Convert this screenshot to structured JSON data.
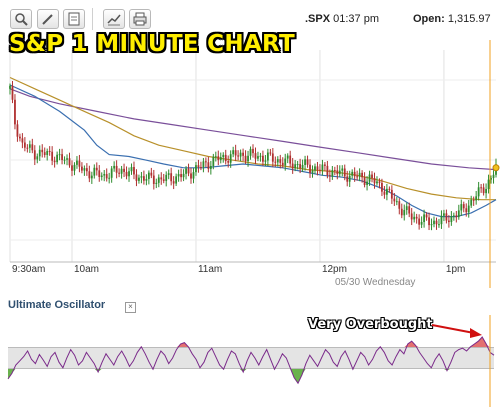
{
  "toolbar": {
    "buttons": [
      "zoom-icon",
      "pencil-icon",
      "notes-icon",
      "chart-icon",
      "print-icon"
    ],
    "symbol": ".SPX",
    "time": "01:37 pm",
    "open_label": "Open:",
    "open_value": "1,315.97"
  },
  "title": "S&P 1 MINUTE CHART",
  "colors": {
    "up_candle": "#2e8b2e",
    "down_candle": "#b03030",
    "ma_fast": "#3a6fb0",
    "ma_mid": "#b8902a",
    "ma_slow": "#7a4f9a",
    "cursor_line": "#f0a020",
    "osc_line": "#7a2a8a",
    "osc_high_fill": "#e06060",
    "osc_low_fill": "#5aaa3a",
    "osc_band": "#e4e4e4"
  },
  "chart_data": [
    {
      "type": "candlestick",
      "x_ticks": [
        "9:30am",
        "10am",
        "11am",
        "12pm",
        "1pm"
      ],
      "date_label": "05/30 Wednesday",
      "grid": true,
      "ylim": [
        0,
        100
      ],
      "close_path": [
        [
          0,
          90
        ],
        [
          2,
          72
        ],
        [
          5,
          60
        ],
        [
          10,
          56
        ],
        [
          16,
          55
        ],
        [
          22,
          52
        ],
        [
          28,
          48
        ],
        [
          33,
          45
        ],
        [
          38,
          44
        ],
        [
          45,
          47
        ],
        [
          50,
          44
        ],
        [
          56,
          42
        ],
        [
          63,
          42
        ],
        [
          70,
          44
        ],
        [
          76,
          48
        ],
        [
          82,
          52
        ],
        [
          88,
          54
        ],
        [
          94,
          55
        ],
        [
          101,
          54
        ],
        [
          108,
          52
        ],
        [
          115,
          50
        ],
        [
          122,
          48
        ],
        [
          130,
          46
        ],
        [
          137,
          44
        ],
        [
          145,
          42
        ],
        [
          150,
          38
        ],
        [
          154,
          32
        ],
        [
          158,
          26
        ],
        [
          162,
          22
        ],
        [
          166,
          20
        ],
        [
          170,
          19
        ],
        [
          174,
          20
        ],
        [
          178,
          22
        ],
        [
          182,
          25
        ],
        [
          186,
          30
        ],
        [
          190,
          36
        ],
        [
          194,
          42
        ],
        [
          196,
          48
        ]
      ],
      "ma_slow": [
        [
          0,
          90
        ],
        [
          8,
          86
        ],
        [
          20,
          82
        ],
        [
          35,
          78
        ],
        [
          50,
          74
        ],
        [
          65,
          71
        ],
        [
          80,
          68
        ],
        [
          95,
          65
        ],
        [
          110,
          62
        ],
        [
          125,
          59
        ],
        [
          140,
          56
        ],
        [
          155,
          53
        ],
        [
          170,
          50
        ],
        [
          185,
          48
        ],
        [
          196,
          47
        ]
      ],
      "ma_mid": [
        [
          0,
          96
        ],
        [
          10,
          90
        ],
        [
          20,
          84
        ],
        [
          30,
          78
        ],
        [
          40,
          72
        ],
        [
          50,
          65
        ],
        [
          60,
          60
        ],
        [
          70,
          57
        ],
        [
          80,
          54
        ],
        [
          90,
          52
        ],
        [
          100,
          50
        ],
        [
          110,
          49
        ],
        [
          120,
          47
        ],
        [
          130,
          46
        ],
        [
          140,
          44
        ],
        [
          150,
          41
        ],
        [
          160,
          37
        ],
        [
          170,
          34
        ],
        [
          180,
          32
        ],
        [
          190,
          31
        ],
        [
          196,
          31
        ]
      ],
      "ma_fast": [
        [
          0,
          92
        ],
        [
          10,
          86
        ],
        [
          20,
          78
        ],
        [
          30,
          68
        ],
        [
          35,
          60
        ],
        [
          40,
          55
        ],
        [
          48,
          54
        ],
        [
          55,
          52
        ],
        [
          62,
          50
        ],
        [
          70,
          48
        ],
        [
          78,
          48
        ],
        [
          86,
          49
        ],
        [
          94,
          50
        ],
        [
          102,
          49
        ],
        [
          110,
          48
        ],
        [
          118,
          46
        ],
        [
          126,
          44
        ],
        [
          134,
          43
        ],
        [
          142,
          41
        ],
        [
          150,
          37
        ],
        [
          156,
          33
        ],
        [
          162,
          28
        ],
        [
          168,
          24
        ],
        [
          174,
          22
        ],
        [
          180,
          22
        ],
        [
          186,
          24
        ],
        [
          192,
          28
        ],
        [
          196,
          31
        ]
      ]
    },
    {
      "type": "line",
      "title": "Ultimate Oscillator",
      "annotation": "Very Overbought",
      "ylim": [
        0,
        100
      ],
      "band": [
        35,
        65
      ],
      "values": [
        20,
        28,
        40,
        46,
        52,
        60,
        48,
        42,
        55,
        47,
        38,
        52,
        58,
        44,
        36,
        50,
        62,
        54,
        40,
        46,
        58,
        50,
        42,
        30,
        44,
        56,
        48,
        40,
        52,
        60,
        50,
        38,
        46,
        58,
        66,
        56,
        44,
        34,
        48,
        60,
        54,
        42,
        50,
        62,
        70,
        72,
        66,
        56,
        48,
        36,
        44,
        58,
        64,
        52,
        40,
        34,
        48,
        60,
        56,
        42,
        30,
        46,
        58,
        50,
        40,
        52,
        62,
        48,
        34,
        44,
        56,
        50,
        36,
        22,
        14,
        26,
        42,
        54,
        46,
        38,
        50,
        62,
        56,
        44,
        38,
        52,
        60,
        48,
        34,
        46,
        58,
        52,
        40,
        48,
        60,
        66,
        58,
        46,
        40,
        52,
        62,
        56,
        70,
        74,
        68,
        58,
        50,
        42,
        36,
        48,
        56,
        46,
        32,
        44,
        58,
        62,
        64,
        60,
        66,
        70,
        74,
        80,
        70,
        58,
        54
      ]
    }
  ]
}
